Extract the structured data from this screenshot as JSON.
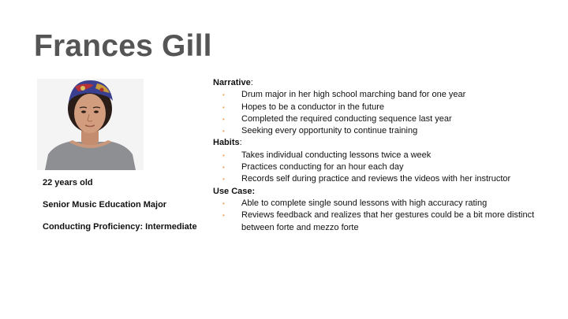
{
  "title": "Frances Gill",
  "facts": {
    "age": "22 years old",
    "major": "Senior Music Education Major",
    "proficiency": "Conducting Proficiency: Intermediate"
  },
  "sections": [
    {
      "heading": "Narrative",
      "colon": ":",
      "bullets": [
        "Drum major in her high school marching band for one year",
        "Hopes to be a conductor in the future",
        "Completed the required conducting sequence last year",
        "Seeking every opportunity to continue training"
      ]
    },
    {
      "heading": "Habits",
      "colon": ":",
      "bullets": [
        "Takes individual conducting lessons twice a week",
        "Practices conducting for an hour each day",
        "Records self during practice and reviews the videos with her instructor"
      ]
    },
    {
      "heading": "Use Case:",
      "colon": "",
      "bullets": [
        "Able to complete single sound lessons with high accuracy rating",
        "Reviews feedback and realizes that her gestures could be a bit more distinct between forte and mezzo forte"
      ]
    }
  ],
  "colors": {
    "title": "#555555",
    "bullet": "#f0a35a",
    "text": "#111111"
  }
}
